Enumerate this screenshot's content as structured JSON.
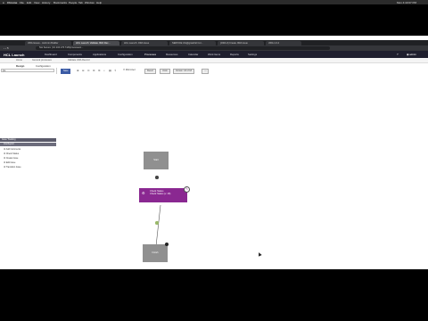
{
  "menubar": {
    "app": "Chrome",
    "items": [
      "File",
      "Edit",
      "View",
      "History",
      "Bookmarks",
      "People",
      "Tab",
      "Window",
      "Help"
    ],
    "clock": "Mon 4:43:07 PM"
  },
  "tabs": [
    "JIRA Issues - Jazzmin Builder",
    "HCL Launch: Validate JIRA Rec...",
    "HCL Launch: JIRA Issue",
    "SERVICE UG@gmail El Cor...",
    "[JIRA-0] Create JIRA issue",
    "JIRA 1.0.4"
  ],
  "address": {
    "prefix": "Not Secure",
    "url": "10.134.176.74/#/processes/..."
  },
  "app_nav": {
    "brand": "HCL Launch",
    "items": [
      "Dashboard",
      "Components",
      "Applications",
      "Configuration",
      "Processes",
      "Resources",
      "Calendar",
      "Work Items",
      "Reports",
      "Settings"
    ],
    "active": "Processes",
    "user": "admin"
  },
  "breadcrumbs": [
    "Home",
    "General processes",
    "Validate JIRA Record"
  ],
  "subtabs": {
    "design": "Design",
    "configuration": "Configuration"
  },
  "sidebar": {
    "search_value": "jira",
    "categories": [
      "Issue Tracking",
      "Jira Report"
    ],
    "items": [
      "Add Comments",
      "Check Status",
      "Create Issue",
      "Edit Issue",
      "Transition Issue"
    ]
  },
  "toolbar": {
    "save": "Save",
    "cancel": "Cancel",
    "minimized_label": "Minimized",
    "revert_label": "Revert",
    "undo": "Undo",
    "version": "Version: 18 of 18"
  },
  "nodes": {
    "start": "Start",
    "step_line1": "Check Status",
    "step_line2": "Check Status (v. 18)",
    "finish": "Finish"
  },
  "colors": {
    "step": "#8a2891",
    "terminal": "#909090",
    "save": "#3b5ba5"
  }
}
